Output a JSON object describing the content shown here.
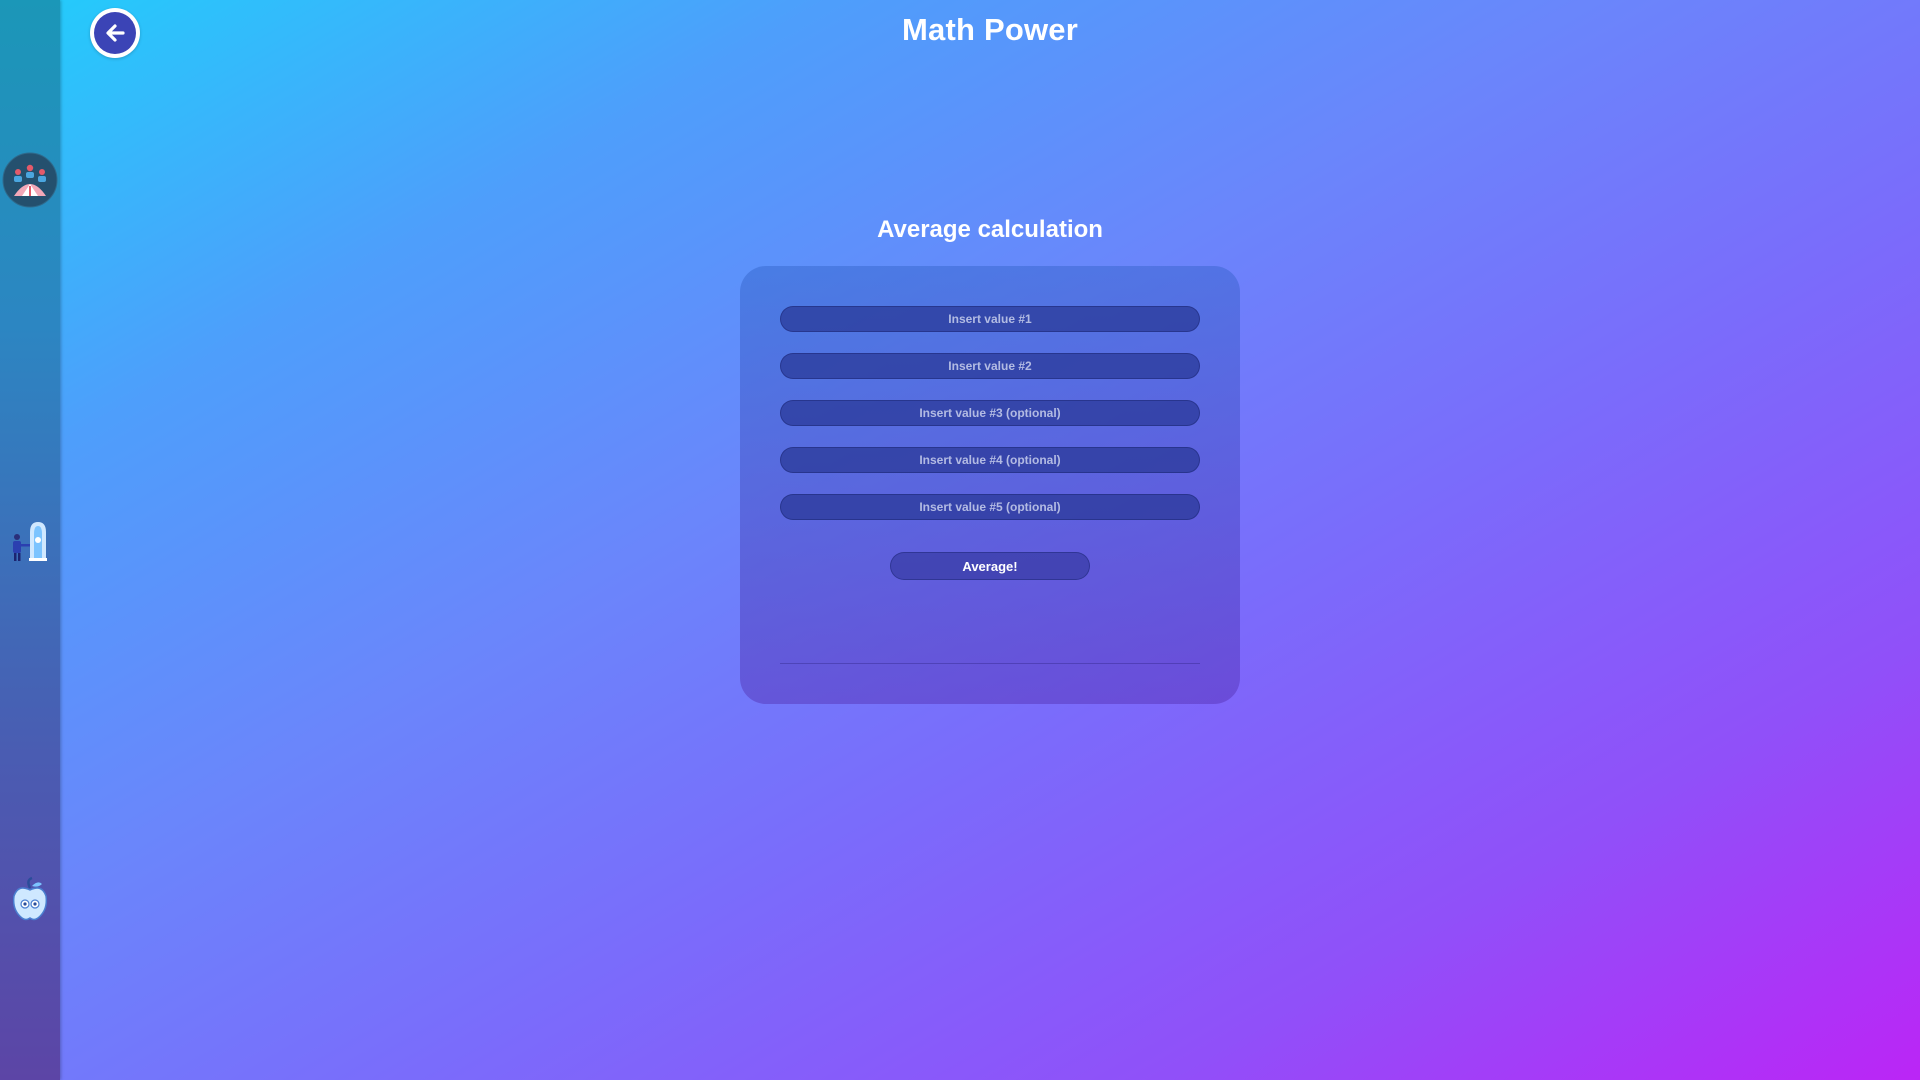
{
  "header": {
    "title": "Math Power"
  },
  "calculator": {
    "title": "Average calculation",
    "fields": [
      {
        "placeholder": "Insert value #1",
        "value": ""
      },
      {
        "placeholder": "Insert value #2",
        "value": ""
      },
      {
        "placeholder": "Insert value #3 (optional)",
        "value": ""
      },
      {
        "placeholder": "Insert value #4 (optional)",
        "value": ""
      },
      {
        "placeholder": "Insert value #5 (optional)",
        "value": ""
      }
    ],
    "submit_label": "Average!"
  },
  "sidebar": {
    "items": [
      {
        "icon": "group-dashboard-icon"
      },
      {
        "icon": "person-building-icon"
      },
      {
        "icon": "apple-icon"
      }
    ]
  },
  "colors": {
    "gradient_start": "#22cdfb",
    "gradient_end": "#bb25f6",
    "back_button": "#3b44b6",
    "field_background": "#2f3b9a"
  }
}
